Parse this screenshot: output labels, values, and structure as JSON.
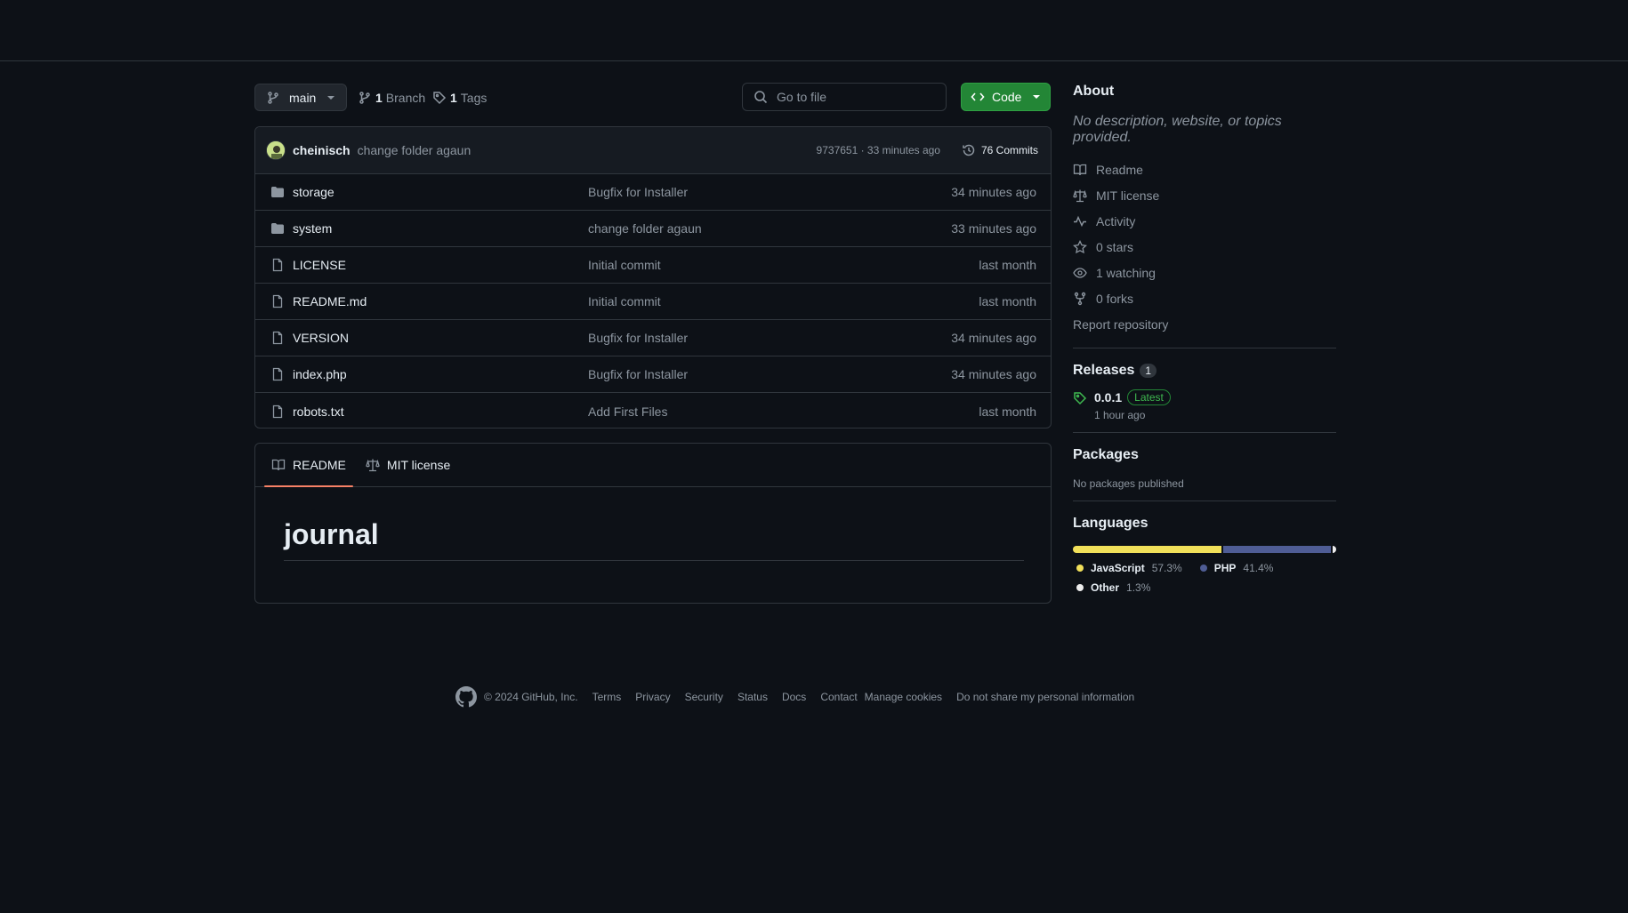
{
  "toolbar": {
    "branch_name": "main",
    "branches_count": "1",
    "branches_label": "Branch",
    "tags_count": "1",
    "tags_label": "Tags",
    "goto_placeholder": "Go to file",
    "code_label": "Code"
  },
  "commit": {
    "author": "cheinisch",
    "message": "change folder agaun",
    "meta": "9737651 · 33 minutes ago",
    "commits_label": "76 Commits"
  },
  "files": [
    {
      "name": "storage",
      "type": "folder",
      "commit": "Bugfix for Installer",
      "age": "34 minutes ago"
    },
    {
      "name": "system",
      "type": "folder",
      "commit": "change folder agaun",
      "age": "33 minutes ago"
    },
    {
      "name": "LICENSE",
      "type": "file",
      "commit": "Initial commit",
      "age": "last month"
    },
    {
      "name": "README.md",
      "type": "file",
      "commit": "Initial commit",
      "age": "last month"
    },
    {
      "name": "VERSION",
      "type": "file",
      "commit": "Bugfix for Installer",
      "age": "34 minutes ago"
    },
    {
      "name": "index.php",
      "type": "file",
      "commit": "Bugfix for Installer",
      "age": "34 minutes ago"
    },
    {
      "name": "robots.txt",
      "type": "file",
      "commit": "Add First Files",
      "age": "last month"
    }
  ],
  "readme": {
    "tabs": [
      "README",
      "MIT license"
    ],
    "heading": "journal"
  },
  "about": {
    "title": "About",
    "description": "No description, website, or topics provided.",
    "items": [
      {
        "icon": "book-icon",
        "label": "Readme"
      },
      {
        "icon": "scale-icon",
        "label": "MIT license"
      },
      {
        "icon": "pulse-icon",
        "label": "Activity"
      },
      {
        "icon": "star-icon",
        "label": "0 stars"
      },
      {
        "icon": "eye-icon",
        "label": "1 watching"
      },
      {
        "icon": "fork-icon",
        "label": "0 forks"
      }
    ],
    "report": "Report repository"
  },
  "releases": {
    "title": "Releases",
    "count": "1",
    "tag": "0.0.1",
    "badge": "Latest",
    "time": "1 hour ago"
  },
  "packages": {
    "title": "Packages",
    "empty": "No packages published"
  },
  "languages": {
    "title": "Languages",
    "items": [
      {
        "name": "JavaScript",
        "pct": "57.3%",
        "value": 57.3,
        "color": "#f1e05a"
      },
      {
        "name": "PHP",
        "pct": "41.4%",
        "value": 41.4,
        "color": "#4f5d95"
      },
      {
        "name": "Other",
        "pct": "1.3%",
        "value": 1.3,
        "color": "#ededed"
      }
    ]
  },
  "footer": {
    "copyright": "© 2024 GitHub, Inc.",
    "links": [
      "Terms",
      "Privacy",
      "Security",
      "Status",
      "Docs",
      "Contact",
      "Manage cookies",
      "Do not share my personal information"
    ]
  }
}
